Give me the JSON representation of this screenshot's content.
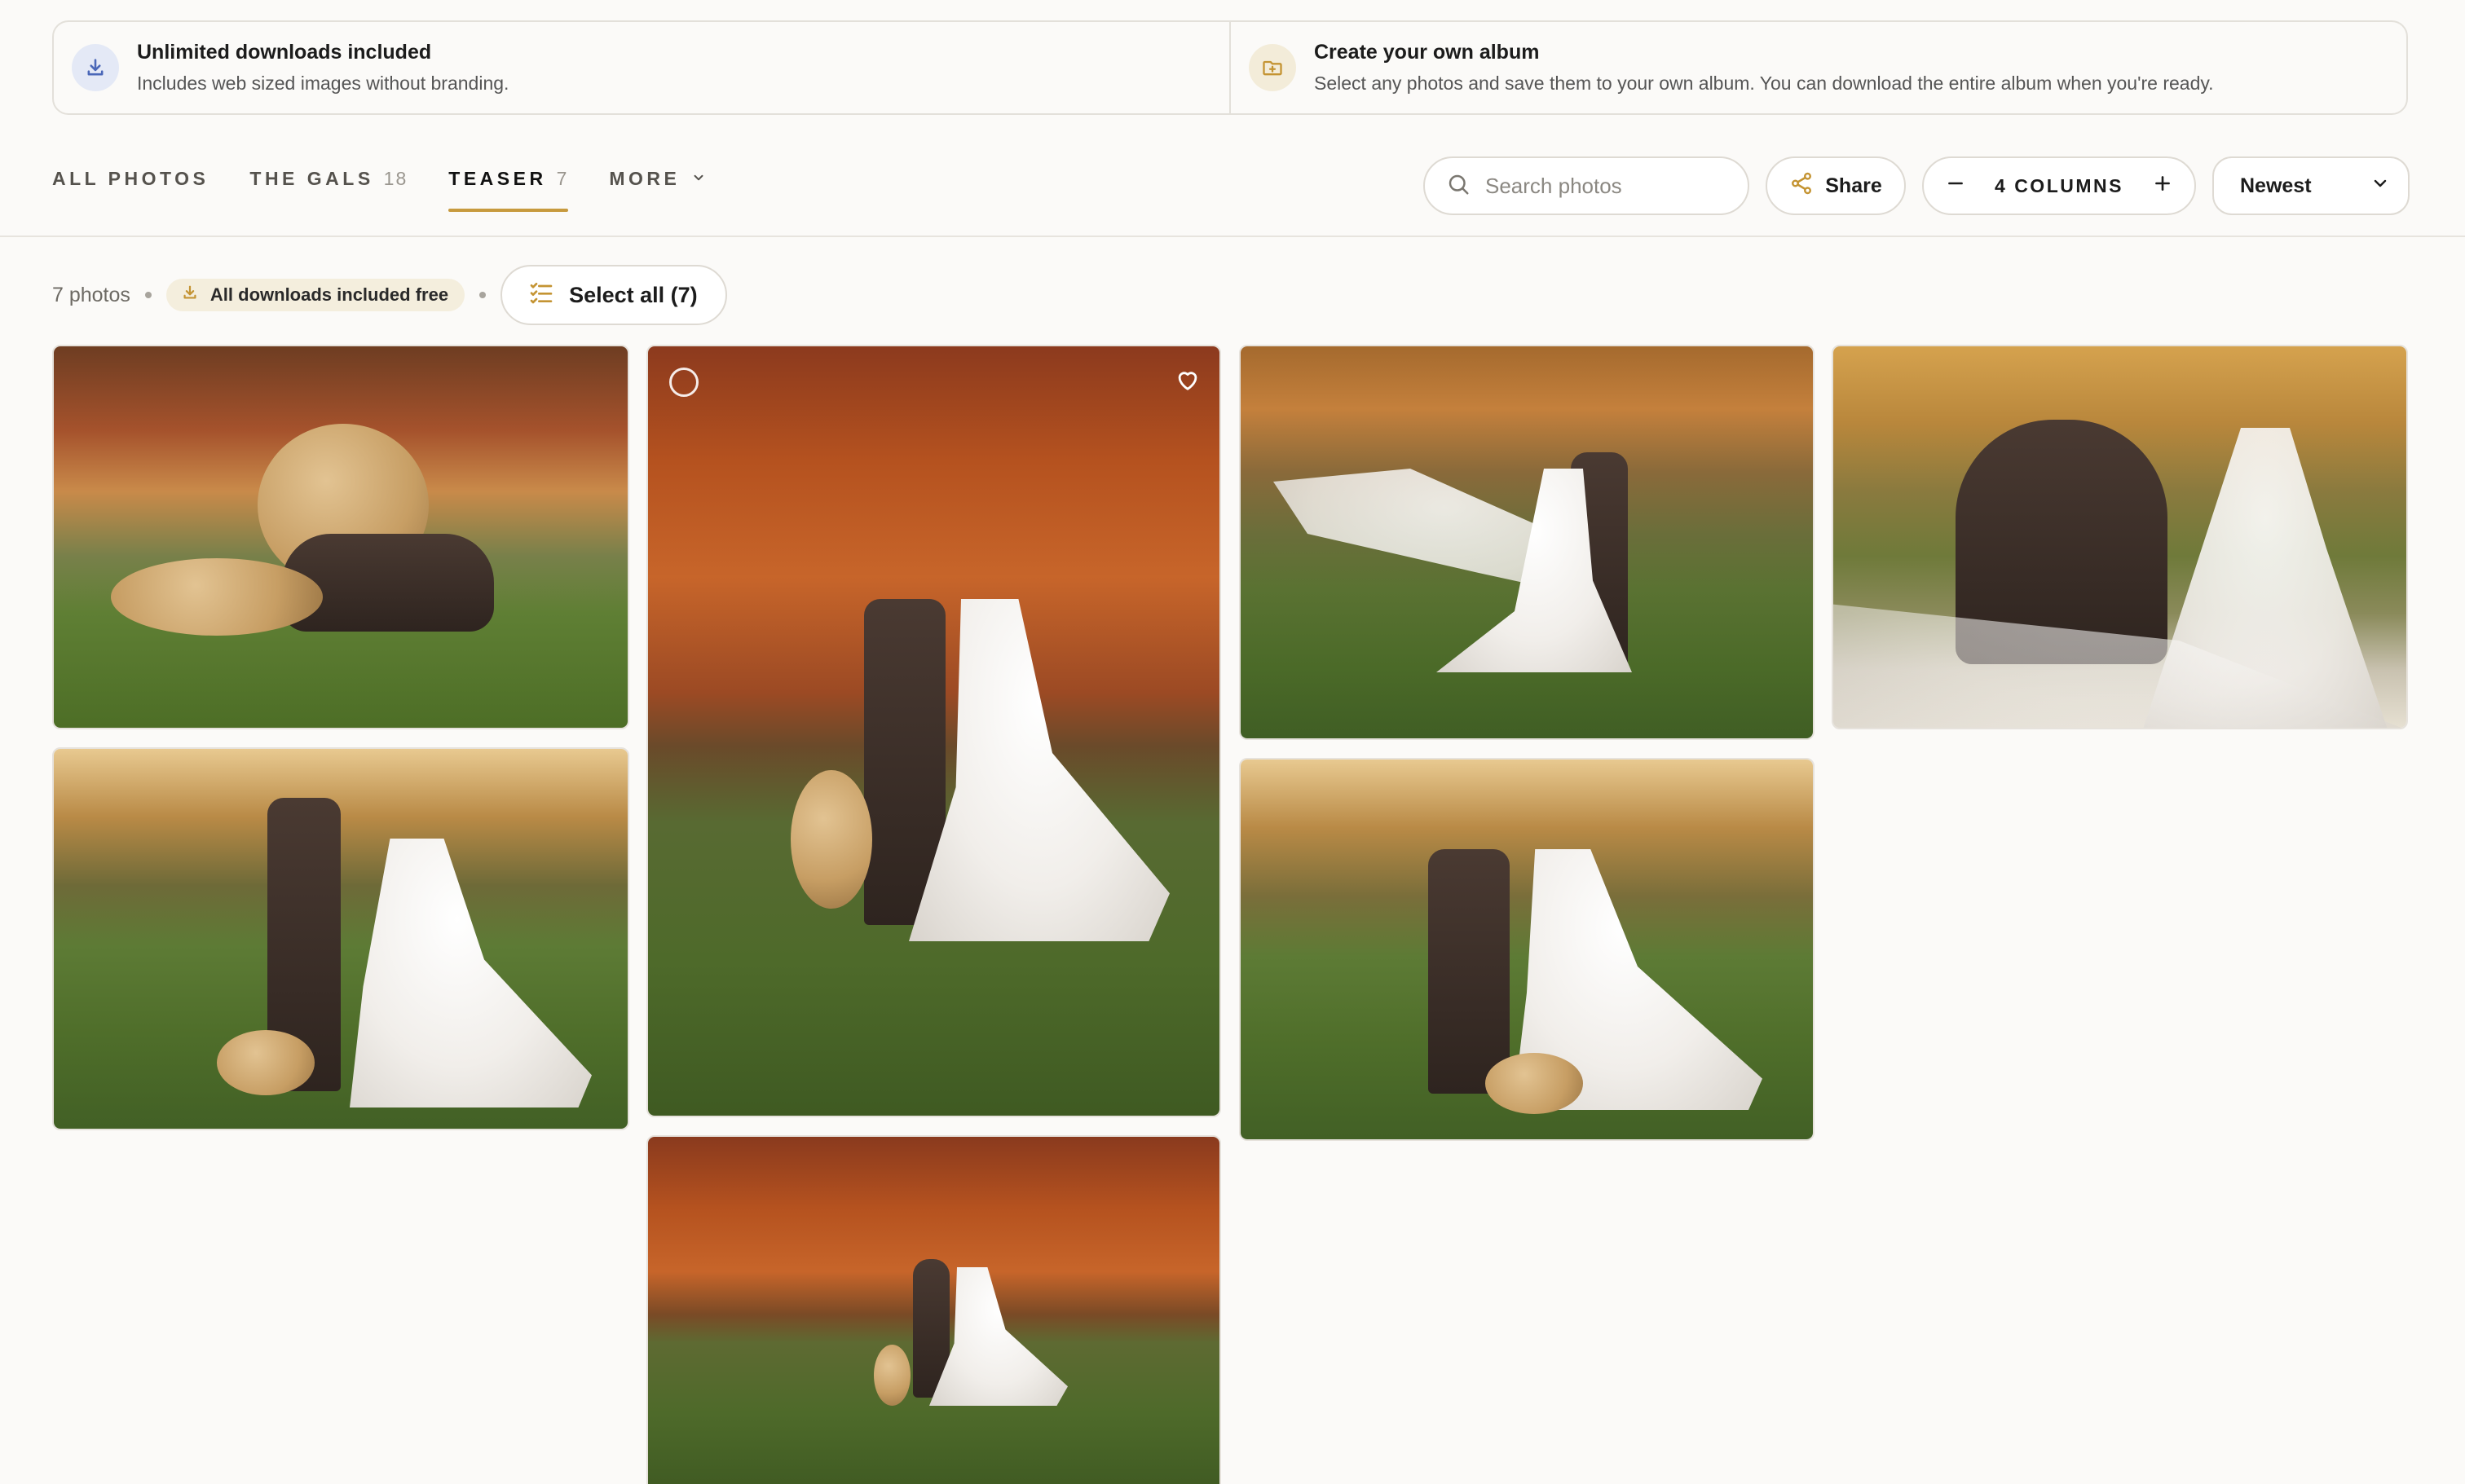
{
  "banner": {
    "downloads": {
      "title": "Unlimited downloads included",
      "subtitle": "Includes web sized images without branding.",
      "icon": "download-icon"
    },
    "album": {
      "title": "Create your own album",
      "subtitle": "Select any photos and save them to your own album. You can download the entire album when you're ready.",
      "icon": "folder-plus-icon"
    }
  },
  "tabs": [
    {
      "label": "ALL PHOTOS",
      "count": ""
    },
    {
      "label": "THE GALS",
      "count": "18"
    },
    {
      "label": "TEASER",
      "count": "7",
      "active": true
    },
    {
      "label": "MORE",
      "count": ""
    }
  ],
  "search": {
    "placeholder": "Search photos"
  },
  "share": {
    "label": "Share"
  },
  "columns": {
    "label": "4 COLUMNS",
    "value": 4
  },
  "sort": {
    "selected": "Newest"
  },
  "meta": {
    "count_text": "7 photos",
    "downloads_badge": "All downloads included free",
    "select_all": "Select all (7)"
  },
  "colors": {
    "accent": "#c79a3e",
    "download_icon": "#4a67b8",
    "folder_icon": "#c49433"
  },
  "photos": [
    {
      "subject": "dog-in-tuxedo-on-grass"
    },
    {
      "subject": "couple-with-dog-autumn-trees-portrait"
    },
    {
      "subject": "bride-veil-flowing-groom"
    },
    {
      "subject": "couple-kissing-closeup-veil"
    },
    {
      "subject": "couple-with-dog-field"
    },
    {
      "subject": "couple-kissing-with-dog"
    },
    {
      "subject": "couple-with-dog-wide-autumn"
    }
  ]
}
